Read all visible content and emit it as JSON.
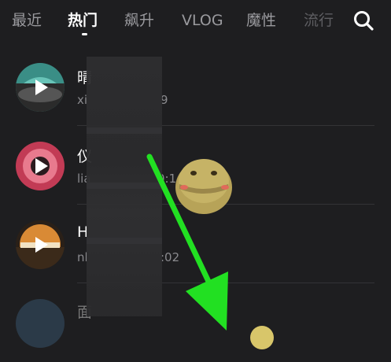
{
  "tabs": [
    {
      "label": "最近",
      "state": "inactive"
    },
    {
      "label": "热门",
      "state": "active"
    },
    {
      "label": "飙升",
      "state": "inactive"
    },
    {
      "label": "VLOG",
      "state": "inactive"
    },
    {
      "label": "魔性",
      "state": "inactive"
    },
    {
      "label": "流行",
      "state": "fade"
    }
  ],
  "search_icon": "search-icon",
  "songs": [
    {
      "title": "晴",
      "sub_prefix": "xi",
      "sub_suffix": "9"
    },
    {
      "title": "仪",
      "sub_prefix": "lia",
      "sub_suffix": "0:1"
    },
    {
      "title": "H",
      "sub_prefix": "nl",
      "sub_suffix": ":02"
    },
    {
      "title": "面",
      "sub_prefix": "",
      "sub_suffix": ""
    }
  ],
  "colors": {
    "background": "#1e1e20",
    "arrow": "#22e022",
    "active_tab": "#ffffff",
    "inactive_tab": "#9a9a9e"
  }
}
